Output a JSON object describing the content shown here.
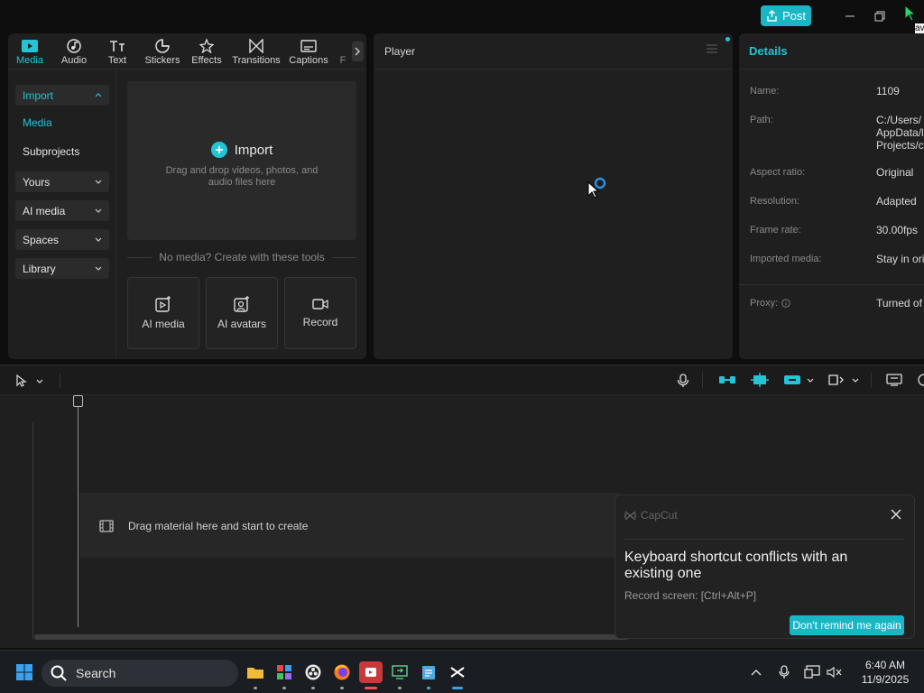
{
  "titlebar": {
    "post_label": "Post"
  },
  "media_tabs": [
    {
      "label": "Media",
      "icon": "media-icon",
      "active": true
    },
    {
      "label": "Audio",
      "icon": "audio-icon"
    },
    {
      "label": "Text",
      "icon": "text-icon"
    },
    {
      "label": "Stickers",
      "icon": "sticker-icon"
    },
    {
      "label": "Effects",
      "icon": "effects-icon"
    },
    {
      "label": "Transitions",
      "icon": "transitions-icon"
    },
    {
      "label": "Captions",
      "icon": "captions-icon"
    },
    {
      "label": "F",
      "icon": "filters-icon"
    }
  ],
  "sidenav": {
    "import": "Import",
    "media": "Media",
    "subprojects": "Subprojects",
    "yours": "Yours",
    "ai_media": "AI media",
    "spaces": "Spaces",
    "library": "Library"
  },
  "import_box": {
    "title": "Import",
    "subtitle": "Drag and drop videos, photos, and audio files here"
  },
  "no_media_text": "No media? Create with these tools",
  "tools": {
    "ai_media": "AI media",
    "ai_avatars": "AI avatars",
    "record": "Record"
  },
  "player": {
    "title": "Player"
  },
  "details": {
    "title": "Details",
    "name_label": "Name:",
    "name_value": "1109",
    "path_label": "Path:",
    "path_line1": "C:/Users/",
    "path_line2": "AppData/l",
    "path_line3": "Projects/c",
    "aspect_label": "Aspect ratio:",
    "aspect_value": "Original",
    "resolution_label": "Resolution:",
    "resolution_value": "Adapted",
    "framerate_label": "Frame rate:",
    "framerate_value": "30.00fps",
    "imported_label": "Imported media:",
    "imported_value": "Stay in ori",
    "proxy_label": "Proxy:",
    "proxy_value": "Turned of"
  },
  "timeline": {
    "drag_text": "Drag material here and start to create"
  },
  "toast": {
    "brand": "CapCut",
    "title": "Keyboard shortcut conflicts with an existing one",
    "detail": "Record screen: [Ctrl+Alt+P]",
    "button": "Don't remind me again"
  },
  "taskbar": {
    "search_label": "Search",
    "time": "6:40 AM",
    "date": "11/9/2025"
  },
  "cursor_tooltip": "av",
  "colors": {
    "accent": "#22c4d6",
    "post": "#19b6c6",
    "bg": "#0e0e0e",
    "panel": "#1f1f1f"
  }
}
